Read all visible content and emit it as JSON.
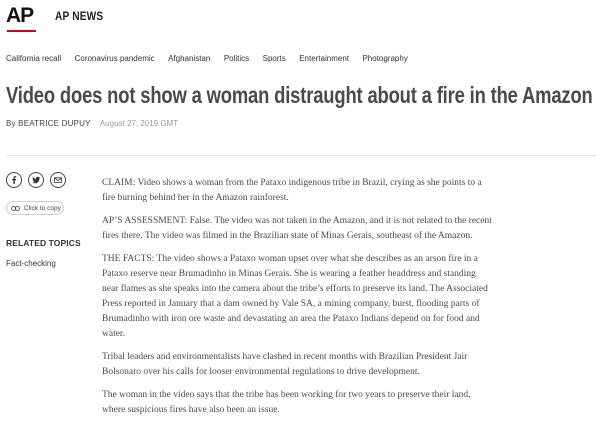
{
  "header": {
    "logo_text": "AP",
    "site_name": "AP NEWS",
    "accent_color": "#d0021b"
  },
  "nav": {
    "items": [
      "California recall",
      "Coronavirus pandemic",
      "Afghanistan",
      "Politics",
      "Sports",
      "Entertainment",
      "Photography"
    ]
  },
  "article": {
    "title": "Video does not show a woman distraught about a fire in the Amazon",
    "author": "By BEATRICE DUPUY",
    "date": "August 27, 2019 GMT",
    "paragraphs": [
      "CLAIM: Video shows a woman from the Pataxo indigenous tribe in Brazil, crying as she points to a fire burning behind her in the Amazon rainforest.",
      "AP’S ASSESSMENT: False. The video was not taken in the Amazon, and it is not related to the recent fires there. The video was filmed in the Brazilian state of Minas Gerais, southeast of the Amazon.",
      "THE FACTS: The video shows a Pataxo woman upset over what she describes as an arson fire in a Pataxo reserve near Brumadinho in Minas Gerais. She is wearing a feather headdress and standing near flames as she speaks into the camera about the tribe’s efforts to preserve its land. The Associated Press reported in January that a dam owned by Vale SA, a mining company, burst, flooding parts of Brumadinho with iron ore waste and devastating an area the Pataxo Indians depend on for food and water.",
      "Tribal leaders and environmentalists have clashed in recent months with Brazilian President Jair Bolsonaro over his calls for looser environmental regulations to drive development.",
      "The woman in the video says that the tribe has been working for two years to preserve their land, where suspicious fires have also been an issue."
    ]
  },
  "sidebar": {
    "share_icons": [
      "facebook-icon",
      "twitter-icon",
      "email-icon"
    ],
    "copy_label": "Click to copy",
    "related_heading": "RELATED TOPICS",
    "related_items": [
      "Fact-checking"
    ]
  }
}
